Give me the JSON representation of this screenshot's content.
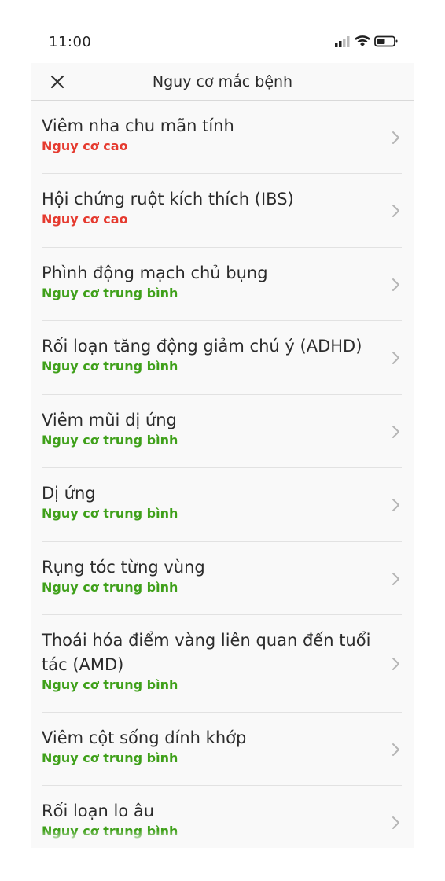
{
  "status_bar": {
    "time": "11:00"
  },
  "header": {
    "title": "Nguy cơ mắc bệnh"
  },
  "colors": {
    "risk_high": "#e53a2f",
    "risk_medium": "#3fa01a"
  },
  "conditions": [
    {
      "name": "Viêm nha chu mãn tính",
      "risk": "Nguy cơ cao",
      "level": "high"
    },
    {
      "name": "Hội chứng ruột kích thích (IBS)",
      "risk": "Nguy cơ cao",
      "level": "high"
    },
    {
      "name": "Phình động mạch chủ bụng",
      "risk": "Nguy cơ trung bình",
      "level": "medium"
    },
    {
      "name": "Rối loạn tăng động giảm chú ý (ADHD)",
      "risk": "Nguy cơ trung bình",
      "level": "medium"
    },
    {
      "name": "Viêm mũi dị ứng",
      "risk": "Nguy cơ trung bình",
      "level": "medium"
    },
    {
      "name": "Dị ứng",
      "risk": "Nguy cơ trung bình",
      "level": "medium"
    },
    {
      "name": "Rụng tóc từng vùng",
      "risk": "Nguy cơ trung bình",
      "level": "medium"
    },
    {
      "name": "Thoái hóa điểm vàng liên quan đến tuổi tác (AMD)",
      "risk": "Nguy cơ trung bình",
      "level": "medium"
    },
    {
      "name": "Viêm cột sống dính khớp",
      "risk": "Nguy cơ trung bình",
      "level": "medium"
    },
    {
      "name": "Rối loạn lo âu",
      "risk": "Nguy cơ trung bình",
      "level": "medium"
    }
  ]
}
